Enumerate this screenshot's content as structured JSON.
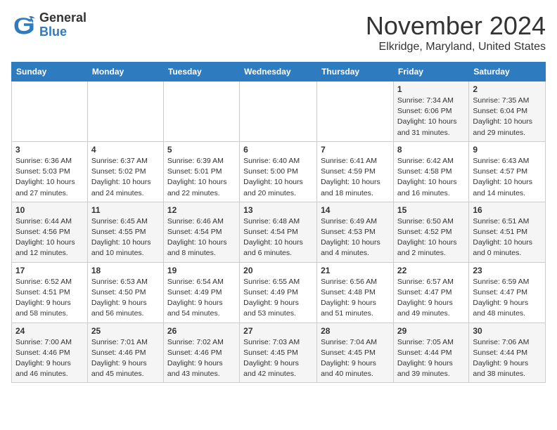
{
  "logo": {
    "general": "General",
    "blue": "Blue"
  },
  "title": "November 2024",
  "location": "Elkridge, Maryland, United States",
  "days_of_week": [
    "Sunday",
    "Monday",
    "Tuesday",
    "Wednesday",
    "Thursday",
    "Friday",
    "Saturday"
  ],
  "weeks": [
    [
      {
        "day": "",
        "info": ""
      },
      {
        "day": "",
        "info": ""
      },
      {
        "day": "",
        "info": ""
      },
      {
        "day": "",
        "info": ""
      },
      {
        "day": "",
        "info": ""
      },
      {
        "day": "1",
        "info": "Sunrise: 7:34 AM\nSunset: 6:06 PM\nDaylight: 10 hours\nand 31 minutes."
      },
      {
        "day": "2",
        "info": "Sunrise: 7:35 AM\nSunset: 6:04 PM\nDaylight: 10 hours\nand 29 minutes."
      }
    ],
    [
      {
        "day": "3",
        "info": "Sunrise: 6:36 AM\nSunset: 5:03 PM\nDaylight: 10 hours\nand 27 minutes."
      },
      {
        "day": "4",
        "info": "Sunrise: 6:37 AM\nSunset: 5:02 PM\nDaylight: 10 hours\nand 24 minutes."
      },
      {
        "day": "5",
        "info": "Sunrise: 6:39 AM\nSunset: 5:01 PM\nDaylight: 10 hours\nand 22 minutes."
      },
      {
        "day": "6",
        "info": "Sunrise: 6:40 AM\nSunset: 5:00 PM\nDaylight: 10 hours\nand 20 minutes."
      },
      {
        "day": "7",
        "info": "Sunrise: 6:41 AM\nSunset: 4:59 PM\nDaylight: 10 hours\nand 18 minutes."
      },
      {
        "day": "8",
        "info": "Sunrise: 6:42 AM\nSunset: 4:58 PM\nDaylight: 10 hours\nand 16 minutes."
      },
      {
        "day": "9",
        "info": "Sunrise: 6:43 AM\nSunset: 4:57 PM\nDaylight: 10 hours\nand 14 minutes."
      }
    ],
    [
      {
        "day": "10",
        "info": "Sunrise: 6:44 AM\nSunset: 4:56 PM\nDaylight: 10 hours\nand 12 minutes."
      },
      {
        "day": "11",
        "info": "Sunrise: 6:45 AM\nSunset: 4:55 PM\nDaylight: 10 hours\nand 10 minutes."
      },
      {
        "day": "12",
        "info": "Sunrise: 6:46 AM\nSunset: 4:54 PM\nDaylight: 10 hours\nand 8 minutes."
      },
      {
        "day": "13",
        "info": "Sunrise: 6:48 AM\nSunset: 4:54 PM\nDaylight: 10 hours\nand 6 minutes."
      },
      {
        "day": "14",
        "info": "Sunrise: 6:49 AM\nSunset: 4:53 PM\nDaylight: 10 hours\nand 4 minutes."
      },
      {
        "day": "15",
        "info": "Sunrise: 6:50 AM\nSunset: 4:52 PM\nDaylight: 10 hours\nand 2 minutes."
      },
      {
        "day": "16",
        "info": "Sunrise: 6:51 AM\nSunset: 4:51 PM\nDaylight: 10 hours\nand 0 minutes."
      }
    ],
    [
      {
        "day": "17",
        "info": "Sunrise: 6:52 AM\nSunset: 4:51 PM\nDaylight: 9 hours\nand 58 minutes."
      },
      {
        "day": "18",
        "info": "Sunrise: 6:53 AM\nSunset: 4:50 PM\nDaylight: 9 hours\nand 56 minutes."
      },
      {
        "day": "19",
        "info": "Sunrise: 6:54 AM\nSunset: 4:49 PM\nDaylight: 9 hours\nand 54 minutes."
      },
      {
        "day": "20",
        "info": "Sunrise: 6:55 AM\nSunset: 4:49 PM\nDaylight: 9 hours\nand 53 minutes."
      },
      {
        "day": "21",
        "info": "Sunrise: 6:56 AM\nSunset: 4:48 PM\nDaylight: 9 hours\nand 51 minutes."
      },
      {
        "day": "22",
        "info": "Sunrise: 6:57 AM\nSunset: 4:47 PM\nDaylight: 9 hours\nand 49 minutes."
      },
      {
        "day": "23",
        "info": "Sunrise: 6:59 AM\nSunset: 4:47 PM\nDaylight: 9 hours\nand 48 minutes."
      }
    ],
    [
      {
        "day": "24",
        "info": "Sunrise: 7:00 AM\nSunset: 4:46 PM\nDaylight: 9 hours\nand 46 minutes."
      },
      {
        "day": "25",
        "info": "Sunrise: 7:01 AM\nSunset: 4:46 PM\nDaylight: 9 hours\nand 45 minutes."
      },
      {
        "day": "26",
        "info": "Sunrise: 7:02 AM\nSunset: 4:46 PM\nDaylight: 9 hours\nand 43 minutes."
      },
      {
        "day": "27",
        "info": "Sunrise: 7:03 AM\nSunset: 4:45 PM\nDaylight: 9 hours\nand 42 minutes."
      },
      {
        "day": "28",
        "info": "Sunrise: 7:04 AM\nSunset: 4:45 PM\nDaylight: 9 hours\nand 40 minutes."
      },
      {
        "day": "29",
        "info": "Sunrise: 7:05 AM\nSunset: 4:44 PM\nDaylight: 9 hours\nand 39 minutes."
      },
      {
        "day": "30",
        "info": "Sunrise: 7:06 AM\nSunset: 4:44 PM\nDaylight: 9 hours\nand 38 minutes."
      }
    ]
  ]
}
